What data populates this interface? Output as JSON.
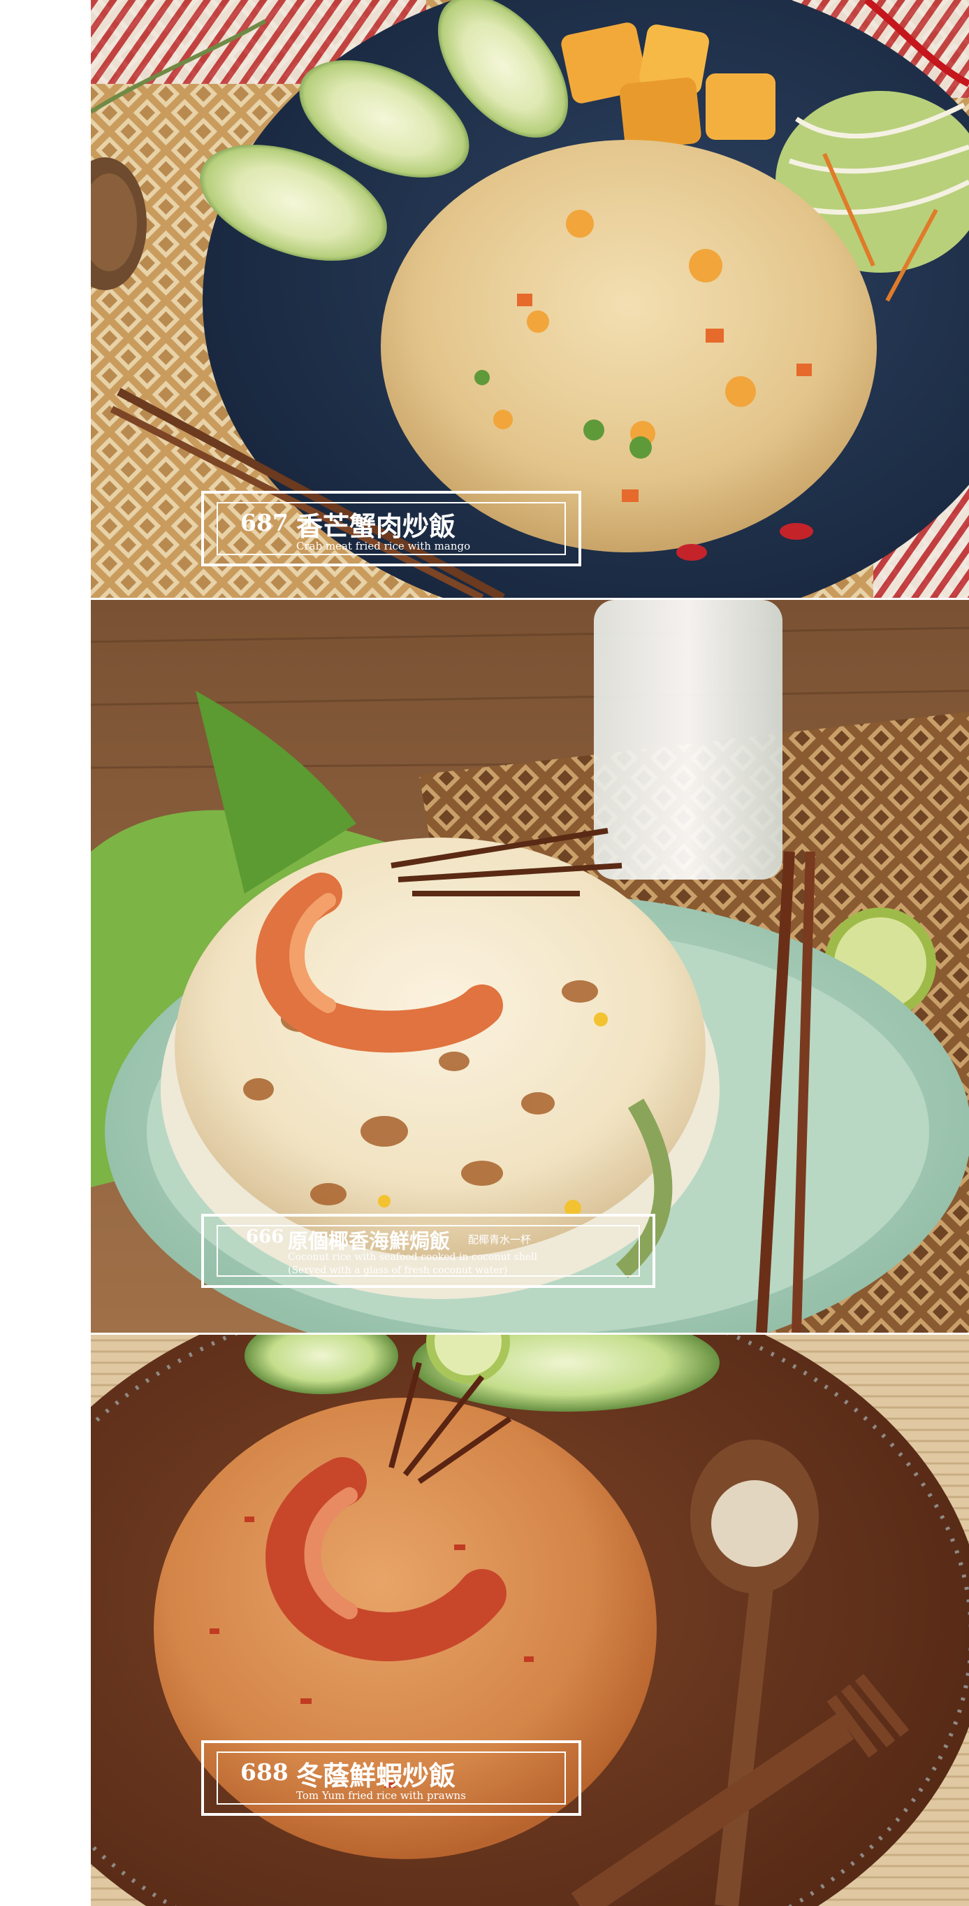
{
  "menu_items": [
    {
      "code": "687",
      "name_zh": "香芒蟹肉炒飯",
      "name_en": "Crab meat fried rice with mango",
      "photo": "crab-mango-fried-rice-photo"
    },
    {
      "code": "666",
      "name_zh": "原個椰香海鮮焗飯",
      "note_zh": "配椰青水一杯",
      "name_en": "Coconut rice with seafood cooked in coconut shell",
      "name_en_note": "(Served with a glass of fresh coconut water)",
      "photo": "coconut-seafood-baked-rice-photo"
    },
    {
      "code": "688",
      "name_zh": "冬蔭鮮蝦炒飯",
      "name_en": "Tom Yum fried rice with prawns",
      "photo": "tom-yum-prawn-fried-rice-photo"
    }
  ],
  "colors": {
    "label_border": "#ffffff",
    "label_text": "#ffffff",
    "plate_navy": "#1f3046",
    "bowl_mint": "#a9cdb9",
    "plate_brown": "#6b3a22"
  }
}
